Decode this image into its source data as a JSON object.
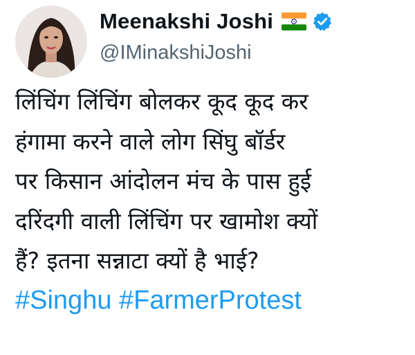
{
  "author": {
    "display_name": "Meenakshi Joshi",
    "handle": "@IMinakshiJoshi",
    "flag_icon": "india-flag-icon",
    "verified_icon": "verified-badge-icon",
    "verified_color": "#1d9bf0"
  },
  "tweet": {
    "lines": [
      "लिंचिंग लिंचिंग बोलकर कूद कूद कर",
      "हंगामा करने वाले लोग सिंघु बॉर्डर",
      "पर किसान आंदोलन मंच के पास हुई",
      "दरिंदगी वाली लिंचिंग पर खामोश क्यों",
      "हैं? इतना सन्नाटा क्यों है भाई?"
    ],
    "hashtags": [
      "#Singhu",
      "#FarmerProtest"
    ],
    "hashtag_color": "#1d9bf0"
  }
}
